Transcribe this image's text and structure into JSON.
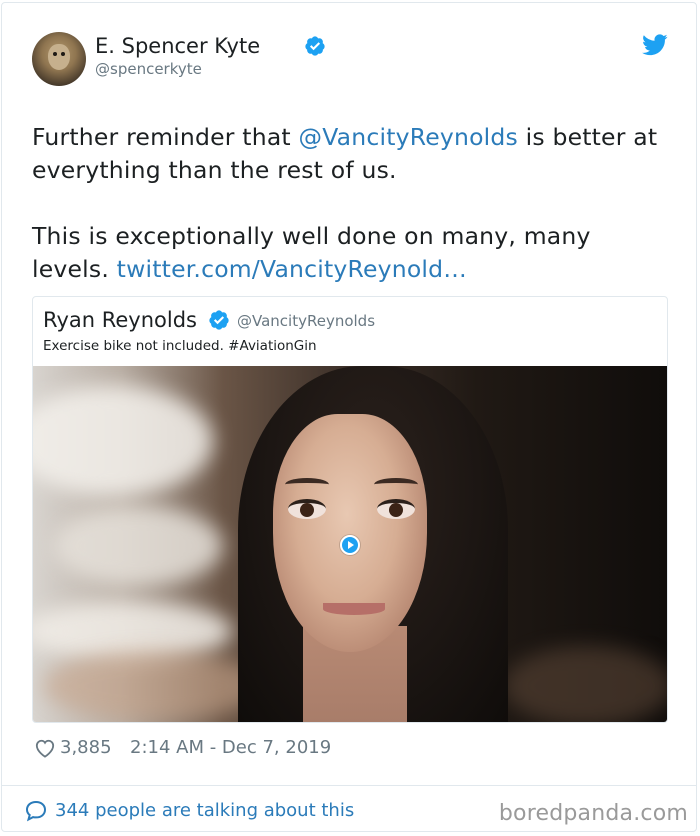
{
  "tweet": {
    "author": {
      "display_name": "E. Spencer Kyte",
      "handle": "@spencerkyte",
      "verified": true
    },
    "text_part1_before_mention": "Further reminder that ",
    "mention": "@VancityReynolds",
    "text_part1_after_mention": " is better at everything than the rest of us.",
    "text_part2": "This is exceptionally well done on many, many levels. ",
    "link_text": "twitter.com/VancityReynold…",
    "quoted_tweet": {
      "display_name": "Ryan Reynolds",
      "handle": "@VancityReynolds",
      "verified": true,
      "text": "Exercise bike not included. #AviationGin",
      "media_type": "video",
      "play_icon": "play-icon"
    },
    "likes": "3,885",
    "timestamp": "2:14 AM - Dec 7, 2019"
  },
  "footer": {
    "conversation_text": "344 people are talking about this",
    "watermark": "boredpanda.com"
  },
  "colors": {
    "link": "#2b7bb9",
    "verified": "#1da1f2",
    "twitter_bird": "#1da1f2",
    "muted": "#697882",
    "border": "#e1e8ed"
  },
  "icons": [
    "verified-badge-icon",
    "twitter-bird-icon",
    "heart-icon",
    "comment-icon",
    "play-icon"
  ]
}
